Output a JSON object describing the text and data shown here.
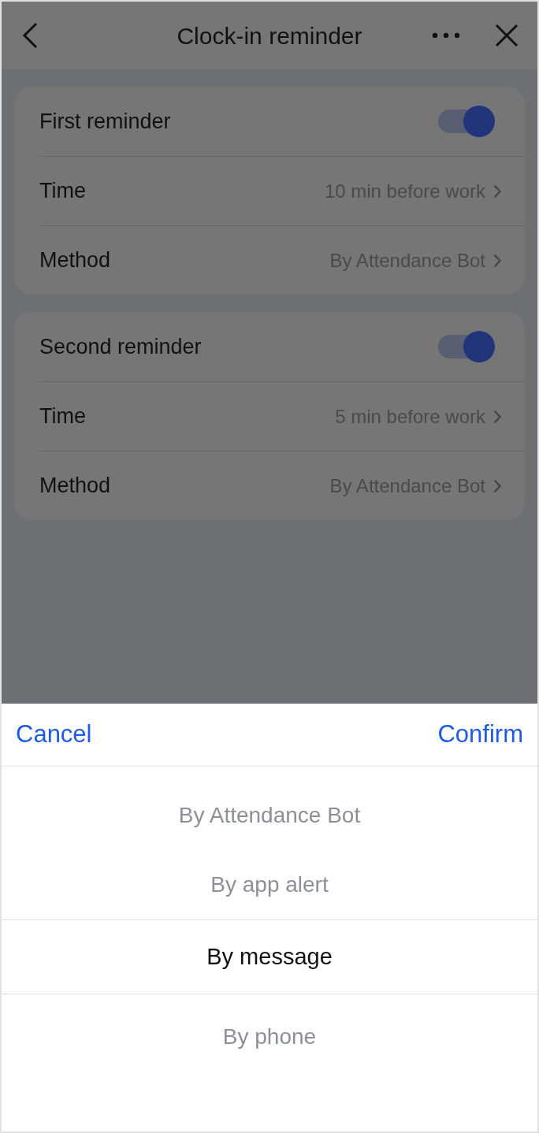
{
  "header": {
    "title": "Clock-in reminder"
  },
  "reminders": [
    {
      "title": "First reminder",
      "on": true,
      "rows": [
        {
          "label": "Time",
          "value": "10 min before work"
        },
        {
          "label": "Method",
          "value": "By Attendance Bot"
        }
      ]
    },
    {
      "title": "Second reminder",
      "on": true,
      "rows": [
        {
          "label": "Time",
          "value": "5 min before work"
        },
        {
          "label": "Method",
          "value": "By Attendance Bot"
        }
      ]
    }
  ],
  "picker": {
    "cancel": "Cancel",
    "confirm": "Confirm",
    "options": [
      {
        "label": "By Attendance Bot",
        "selected": false
      },
      {
        "label": "By app alert",
        "selected": false
      },
      {
        "label": "By message",
        "selected": true
      },
      {
        "label": "By phone",
        "selected": false
      }
    ]
  }
}
